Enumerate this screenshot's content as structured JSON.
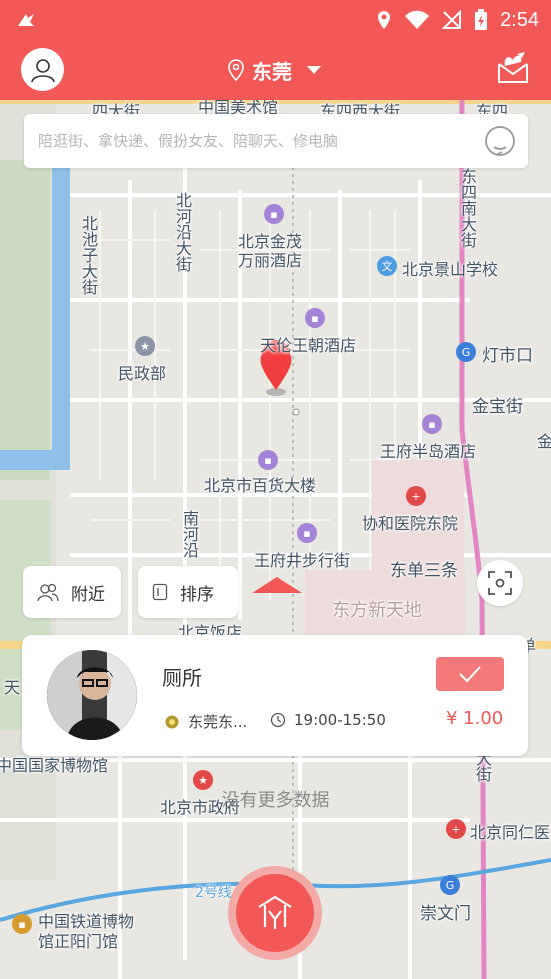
{
  "status_bar": {
    "time": "2:54"
  },
  "header": {
    "city": "东莞"
  },
  "search": {
    "placeholder": "陪逛街、拿快递、假扮女友、陪聊天、修电脑"
  },
  "map_labels": {
    "top1": "四大街",
    "top2": "中国美术馆",
    "top3": "东四西大街",
    "top4": "东四",
    "l1": "北池子大街",
    "l2": "北河沿大街",
    "l3": "北京金茂",
    "l4": "万丽酒店",
    "l5": "北京景山学校",
    "l6": "东四南大街",
    "l7": "天伦王朝酒店",
    "l8": "民政部",
    "l9": "灯市口",
    "l10": "金宝街",
    "l11": "王府半岛酒店",
    "l12": "北京市百货大楼",
    "l13": "协和医院东院",
    "l14": "南河沿",
    "l15": "王府井步行街",
    "l16": "东单三条",
    "l17": "东方新天地",
    "l18": "北京饭店",
    "l19": "东单",
    "l20": "天",
    "l21": "中国国家博物馆",
    "l22": "北京市政府",
    "l23": "北京同仁医",
    "l24": "大街",
    "l25": "2号线",
    "l26": "崇文门",
    "l27": "中国铁道博物",
    "l28": "馆正阳门馆",
    "l29": "金"
  },
  "chips": {
    "nearby": "附近",
    "sort": "排序"
  },
  "card": {
    "title": "厕所",
    "address": "东莞东...",
    "time": "19:00-15:50",
    "price": "¥ 1.00"
  },
  "list_footer": "没有更多数据",
  "colors": {
    "brand": "#f25856",
    "accept": "#f37878"
  },
  "icons": {
    "avatar": "user-icon",
    "location": "map-pin-icon",
    "messages": "bird-envelope-icon",
    "voice": "microphone-icon",
    "nearby": "people-icon",
    "sort": "sort-icon",
    "locate": "crosshair-icon",
    "fab": "publish-icon"
  }
}
